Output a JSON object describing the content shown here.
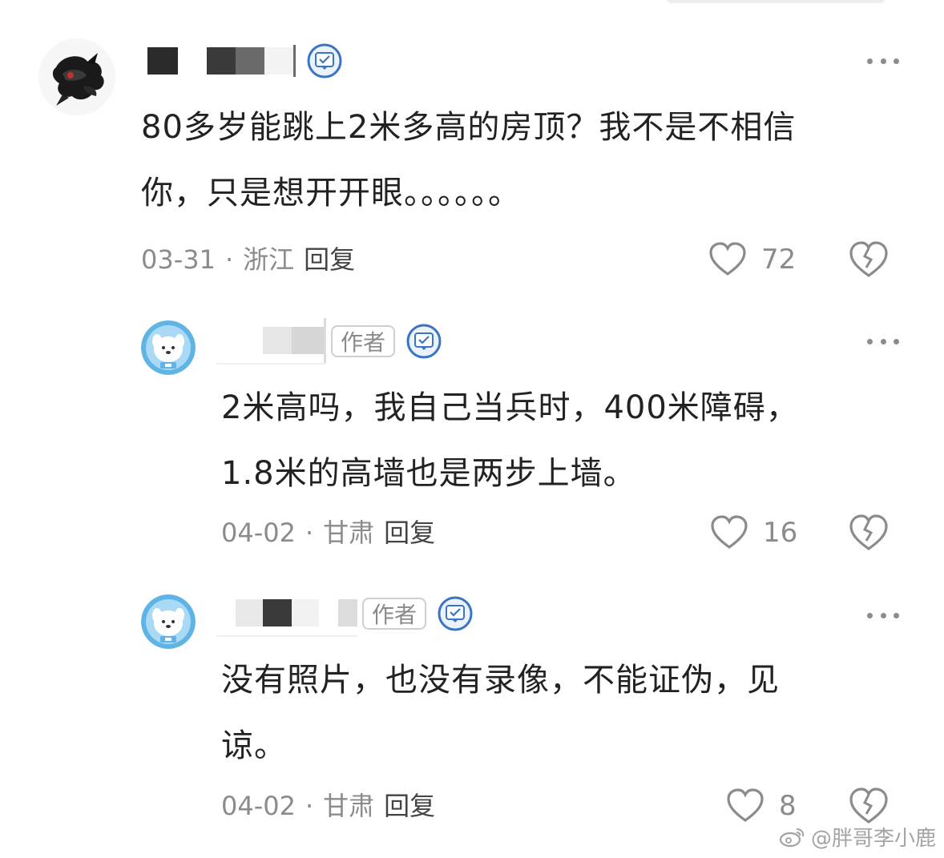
{
  "comments": [
    {
      "content_line1": "80多岁能跳上2米多高的房顶？我不是不相信",
      "content_line2": "你，只是想开开眼。。。。。。",
      "date": "03-31",
      "location": "浙江",
      "reply_label": "回复",
      "likes": "72",
      "separator": "·"
    },
    {
      "author_tag": "作者",
      "content_line1": "2米高吗，我自己当兵时，400米障碍，",
      "content_line2": "1.8米的高墙也是两步上墙。",
      "date": "04-02",
      "location": "甘肃",
      "reply_label": "回复",
      "likes": "16",
      "separator": "·"
    },
    {
      "author_tag": "作者",
      "content_line1": "没有照片，也没有录像，不能证伪，见",
      "content_line2": "谅。",
      "date": "04-02",
      "location": "甘肃",
      "reply_label": "回复",
      "likes": "8",
      "separator": "·"
    }
  ],
  "watermark": "@胖哥李小鹿",
  "icons": {
    "more": "more-icon",
    "like": "heart-icon",
    "dislike": "broken-heart-icon",
    "verify": "verified-badge-icon"
  },
  "colors": {
    "text": "#222222",
    "meta": "#8b8b8b",
    "badge_blue": "#3b74c4",
    "avatar_blue": "#5fb4e6"
  }
}
